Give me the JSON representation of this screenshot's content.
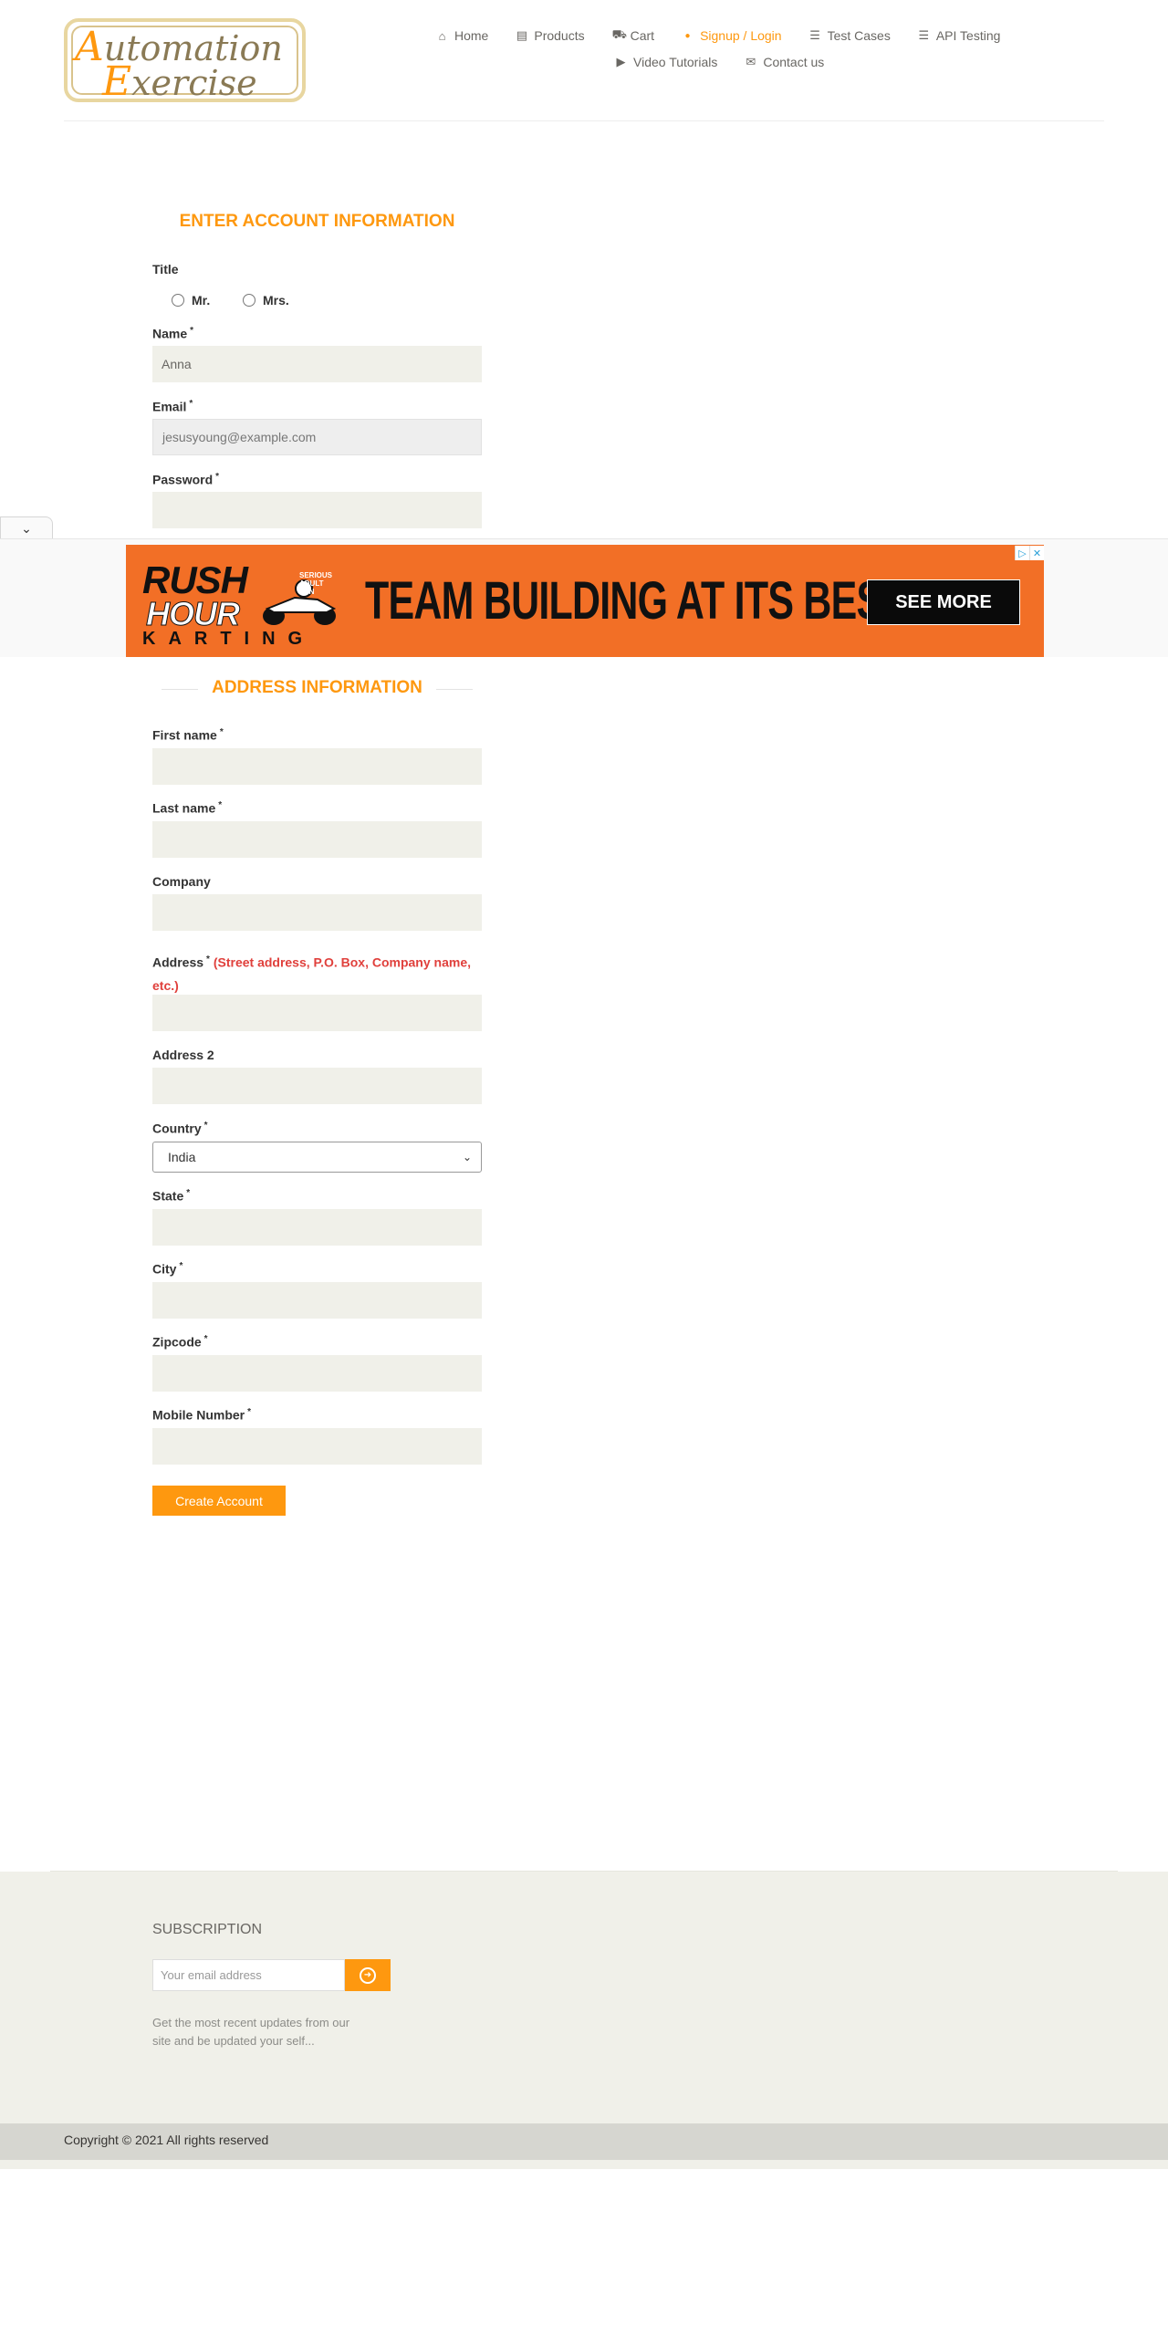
{
  "header": {
    "logo": {
      "line1_cap": "A",
      "line1_rest": "utomation",
      "line2_cap": "E",
      "line2_rest": "xercise"
    },
    "nav": [
      {
        "label": "Home",
        "icon": "home-icon",
        "glyph": "⌂"
      },
      {
        "label": "Products",
        "icon": "products-icon",
        "glyph": "▤"
      },
      {
        "label": "Cart",
        "icon": "cart-icon",
        "glyph": "⛟"
      },
      {
        "label": "Signup / Login",
        "icon": "lock-icon",
        "glyph": "🔒",
        "active": true
      },
      {
        "label": "Test Cases",
        "icon": "list-icon",
        "glyph": "☰"
      },
      {
        "label": "API Testing",
        "icon": "list-icon",
        "glyph": "☰"
      },
      {
        "label": "Video Tutorials",
        "icon": "youtube-icon",
        "glyph": "▶"
      },
      {
        "label": "Contact us",
        "icon": "envelope-icon",
        "glyph": "✉"
      }
    ]
  },
  "account": {
    "heading": "ENTER ACCOUNT INFORMATION",
    "title_label": "Title",
    "title_options": [
      "Mr.",
      "Mrs."
    ],
    "name_label": "Name",
    "name_value": "Anna",
    "email_label": "Email",
    "email_value": "jesusyoung@example.com",
    "password_label": "Password",
    "required_mark": "*"
  },
  "address": {
    "heading": "ADDRESS INFORMATION",
    "first_name_label": "First name",
    "last_name_label": "Last name",
    "company_label": "Company",
    "address_label": "Address",
    "address_hint": "(Street address, P.O. Box, Company name, etc.)",
    "address2_label": "Address 2",
    "country_label": "Country",
    "country_value": "India",
    "state_label": "State",
    "city_label": "City",
    "zipcode_label": "Zipcode",
    "mobile_label": "Mobile Number",
    "create_button": "Create Account"
  },
  "ad": {
    "brand_top": "RUSH",
    "brand_bottom": "HOUR",
    "brand_sub": "KARTING",
    "tagline_small": "SERIOUS ADULT FUN",
    "headline": "TEAM BUILDING AT ITS BEST.",
    "cta": "SEE MORE",
    "collapse_icon": "chevron-down-icon",
    "collapse_glyph": "⌄",
    "adchoices_glyph": "▷",
    "close_glyph": "✕",
    "colors": {
      "banner": "#f26f26",
      "cta": "#0a0a0a"
    }
  },
  "footer": {
    "subscription_title": "SUBSCRIPTION",
    "email_placeholder": "Your email address",
    "subscribe_icon": "arrow-circle-right-icon",
    "subscribe_glyph": "➜",
    "blurb": "Get the most recent updates from our site and be updated your self...",
    "copyright": "Copyright © 2021 All rights reserved"
  },
  "colors": {
    "accent": "#fe980f",
    "field_bg": "#f0f0e9",
    "footer_bg": "#f0f0e9",
    "hint": "#e0403c"
  }
}
